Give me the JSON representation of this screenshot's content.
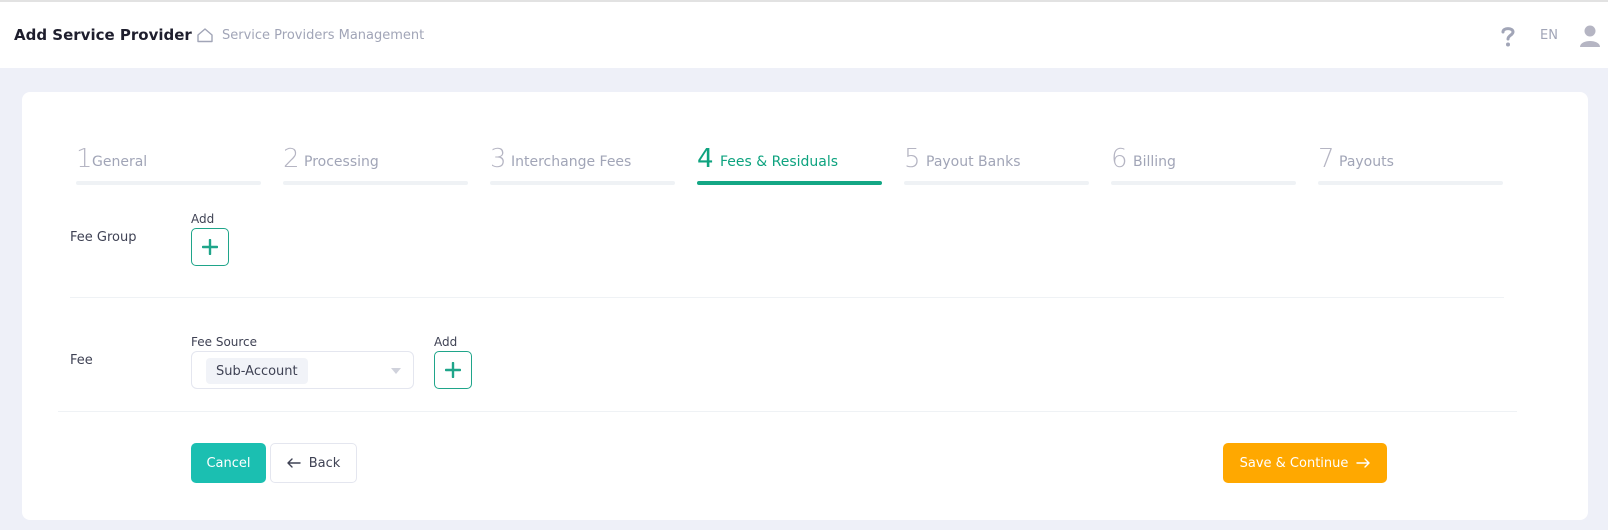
{
  "header": {
    "title": "Add Service Provider",
    "breadcrumb": "Service Providers Management",
    "language": "EN"
  },
  "steps": [
    {
      "number": "1",
      "label": "General",
      "active": false
    },
    {
      "number": "2",
      "label": "Processing",
      "active": false
    },
    {
      "number": "3",
      "label": "Interchange Fees",
      "active": false
    },
    {
      "number": "4",
      "label": "Fees & Residuals",
      "active": true
    },
    {
      "number": "5",
      "label": "Payout Banks",
      "active": false
    },
    {
      "number": "6",
      "label": "Billing",
      "active": false
    },
    {
      "number": "7",
      "label": "Payouts",
      "active": false
    }
  ],
  "fee_group": {
    "label": "Fee Group",
    "add_caption": "Add"
  },
  "fee": {
    "label": "Fee",
    "source_caption": "Fee Source",
    "source_value": "Sub-Account",
    "add_caption": "Add"
  },
  "actions": {
    "cancel": "Cancel",
    "back": "Back",
    "save": "Save & Continue"
  },
  "colors": {
    "accent": "#14a785",
    "cancel": "#1bbfb1",
    "save": "#ffa800"
  },
  "icons": {
    "home": "home-icon",
    "help": "question-icon",
    "user": "user-icon",
    "add": "plus-icon",
    "caret": "chevron-down-icon",
    "back": "arrow-left-icon",
    "forward": "arrow-right-icon"
  }
}
